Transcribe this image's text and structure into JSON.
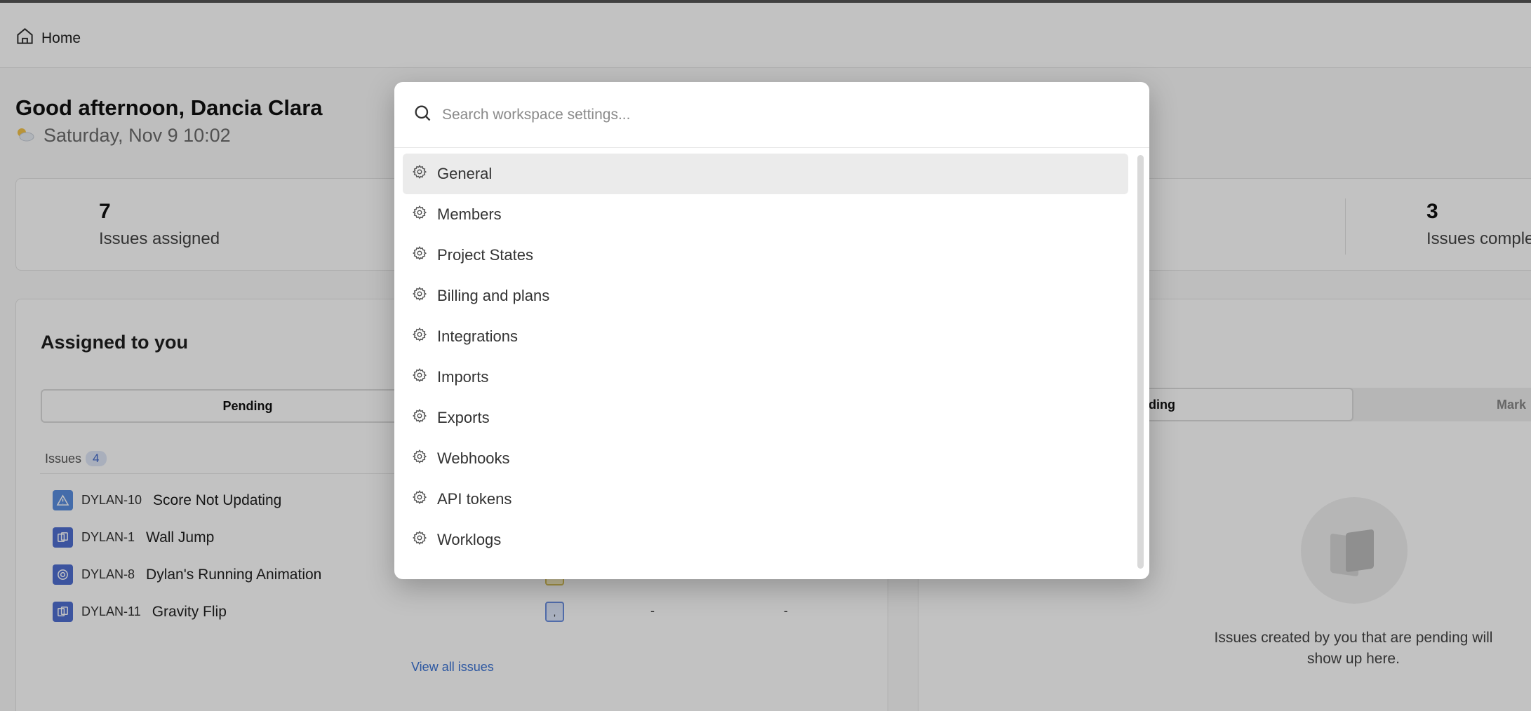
{
  "header": {
    "home_label": "Home"
  },
  "greeting": {
    "title": "Good afternoon, Dancia Clara",
    "date": "Saturday, Nov 9 10:02"
  },
  "stats": [
    {
      "number": "7",
      "label": "Issues assigned"
    },
    {
      "number": "3",
      "label": "Issues comple"
    }
  ],
  "assigned_panel": {
    "title": "Assigned to you",
    "tabs": [
      "Pending"
    ],
    "issues_label": "Issues",
    "issues_count": "4",
    "issues": [
      {
        "id": "DYLAN-10",
        "title": "Score Not Updating",
        "icon": "warning-icon",
        "color": "#5a8ee0"
      },
      {
        "id": "DYLAN-1",
        "title": "Wall Jump",
        "icon": "layers-icon",
        "color": "#4f6fd1"
      },
      {
        "id": "DYLAN-8",
        "title": "Dylan's Running Animation",
        "icon": "target-icon",
        "color": "#4f6fd1"
      },
      {
        "id": "DYLAN-11",
        "title": "Gravity Flip",
        "icon": "layers-icon",
        "color": "#4f6fd1"
      }
    ],
    "row_chip_text": ",",
    "row_dash_1": "-",
    "row_dash_2": "-",
    "view_all": "View all issues"
  },
  "created_panel": {
    "tabs": [
      "ding",
      "Mark"
    ],
    "empty_text": "Issues created by you that are pending will show up here."
  },
  "settings_modal": {
    "search_placeholder": "Search workspace settings...",
    "items": [
      "General",
      "Members",
      "Project States",
      "Billing and plans",
      "Integrations",
      "Imports",
      "Exports",
      "Webhooks",
      "API tokens",
      "Worklogs"
    ],
    "selected_index": 0
  }
}
